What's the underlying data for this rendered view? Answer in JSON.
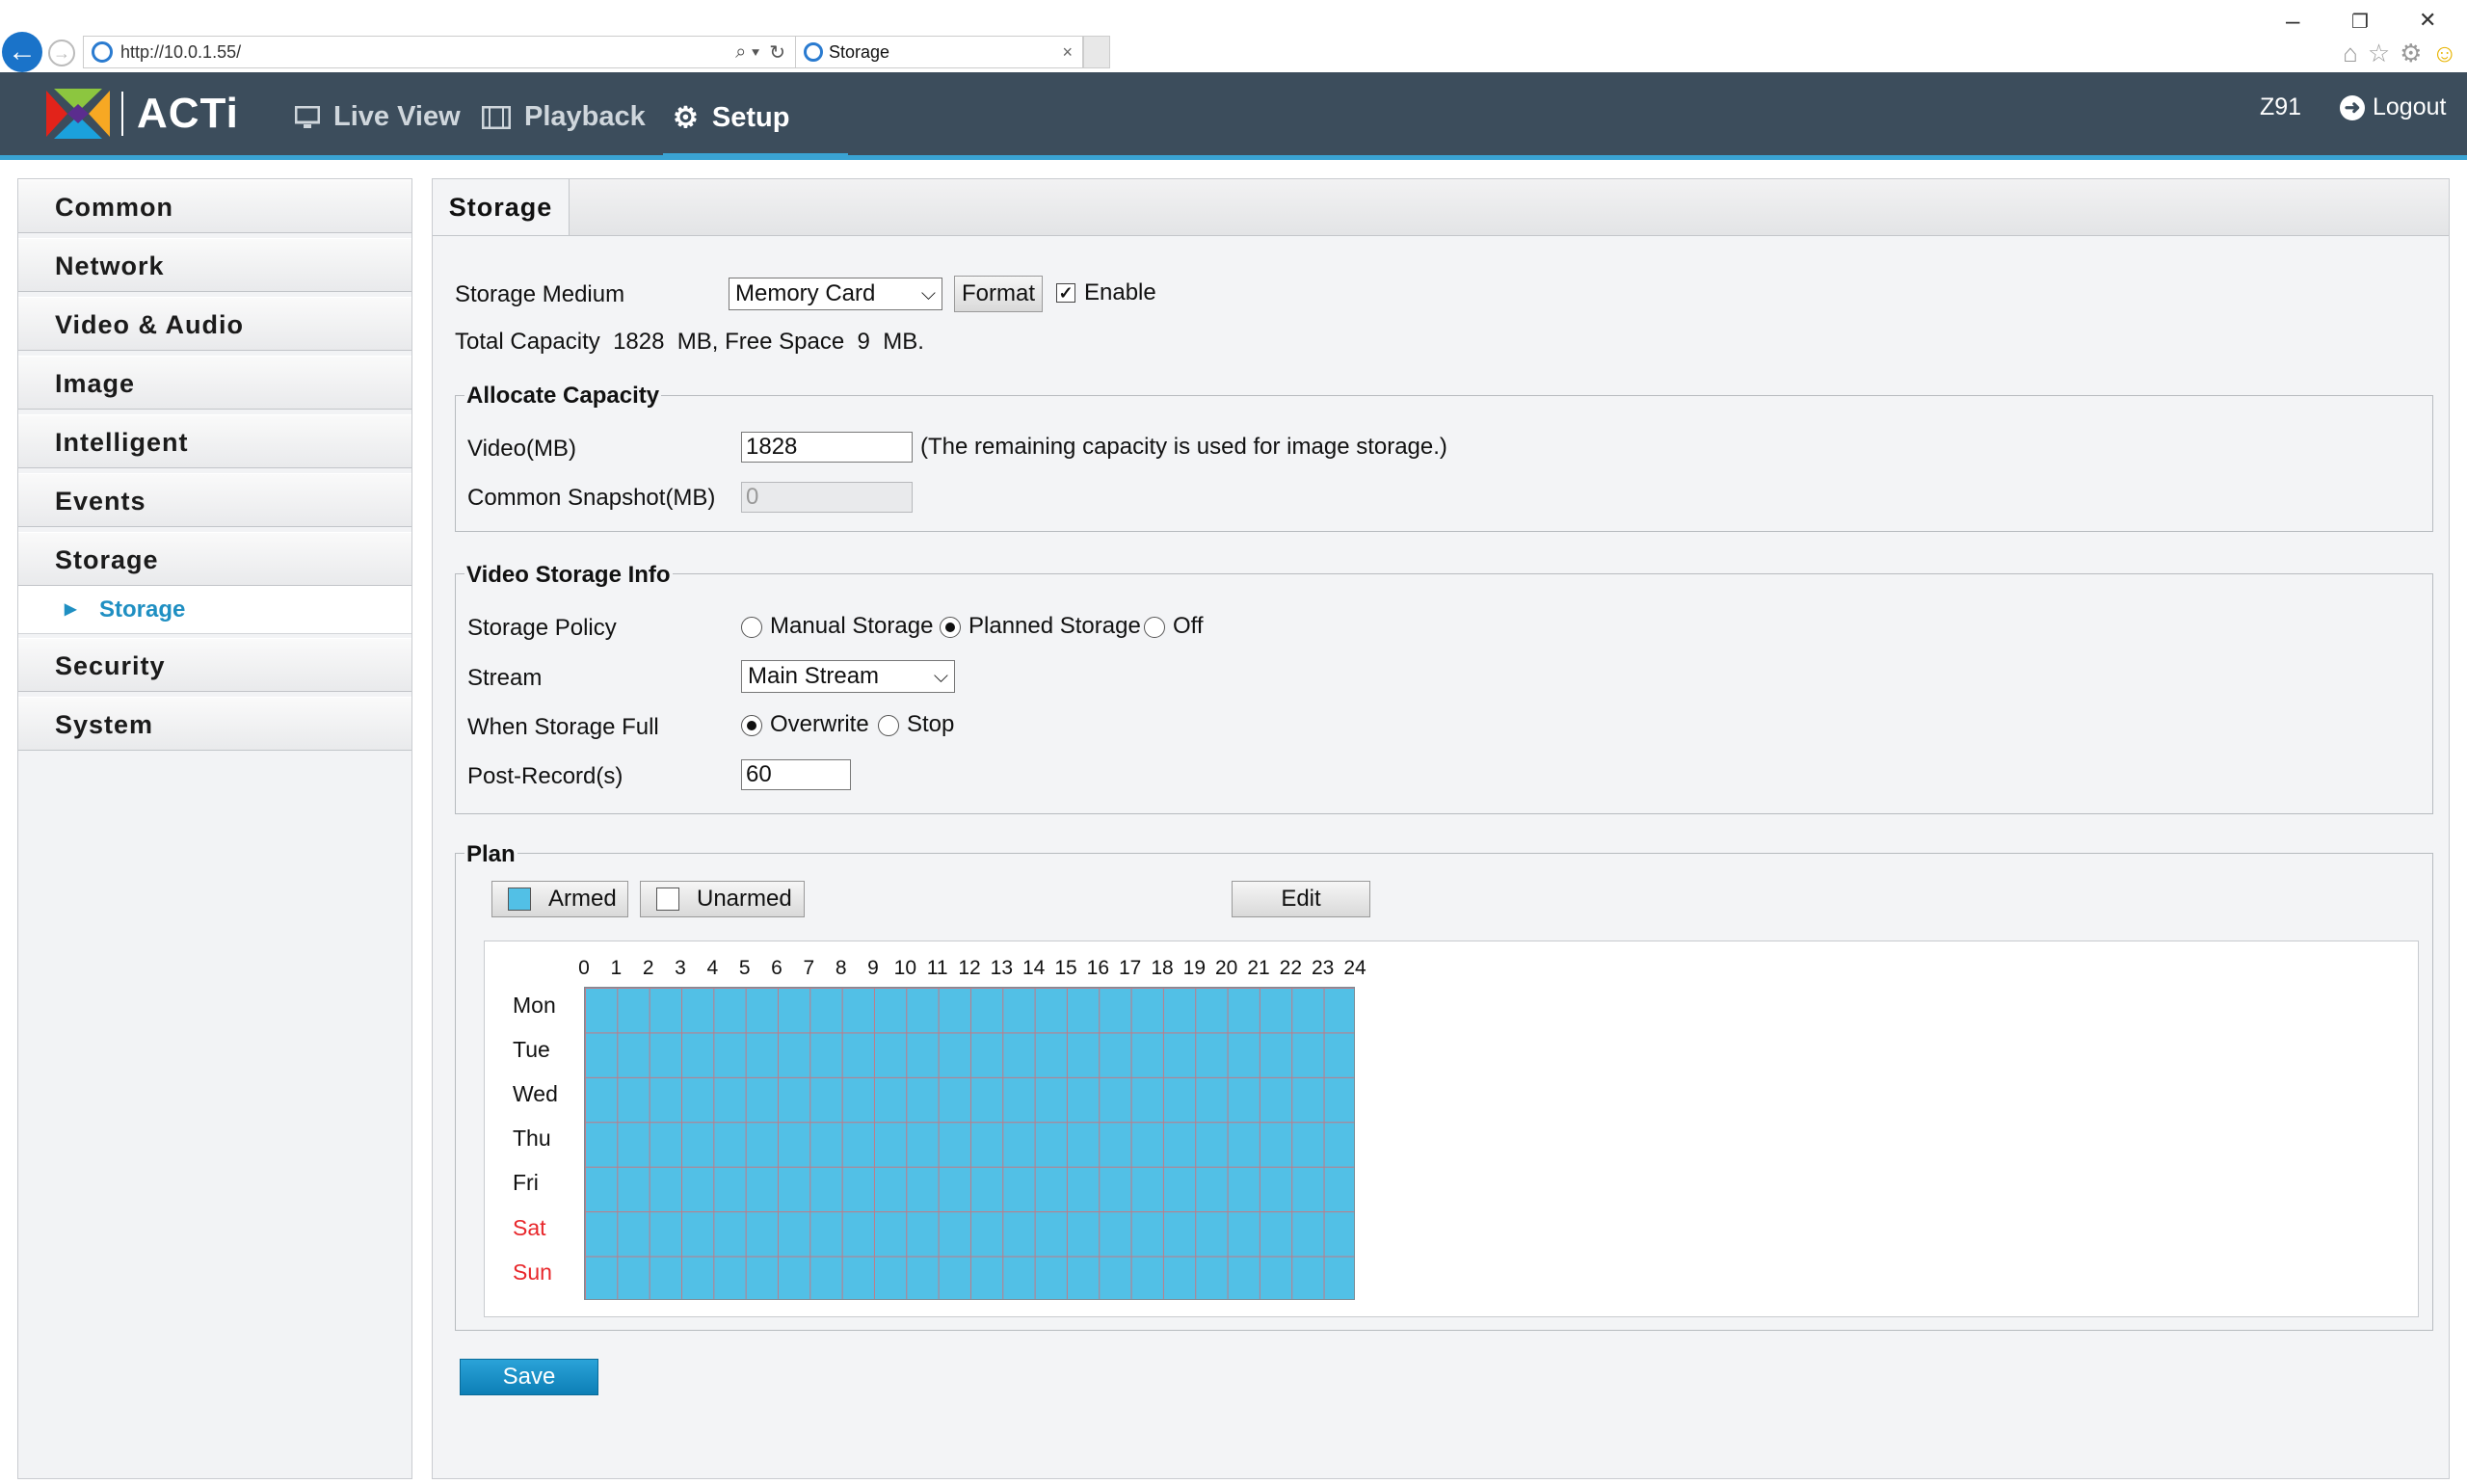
{
  "browser": {
    "url": "http://10.0.1.55/",
    "tab_title": "Storage",
    "tab_close": "×",
    "win_minimize": "–",
    "win_restore": "❐",
    "win_close": "✕"
  },
  "header": {
    "logo_text": "ACTi",
    "menu": {
      "live_view": "Live View",
      "playback": "Playback",
      "setup": "Setup"
    },
    "active_menu": "Setup",
    "device_name": "Z91",
    "logout": "Logout"
  },
  "sidebar": {
    "items": [
      "Common",
      "Network",
      "Video & Audio",
      "Image",
      "Intelligent",
      "Events",
      "Storage",
      "Security",
      "System"
    ],
    "sub_item": "Storage"
  },
  "panel": {
    "tab": "Storage",
    "storage_medium_label": "Storage Medium",
    "storage_medium_value": "Memory Card",
    "format_button": "Format",
    "enable_label": "Enable",
    "enable_checked": true,
    "capacity_text": "Total Capacity  1828  MB, Free Space  9  MB."
  },
  "allocate": {
    "legend": "Allocate Capacity",
    "video_label": "Video(MB)",
    "video_value": "1828",
    "video_note": "(The remaining capacity is used for image storage.)",
    "snapshot_label": "Common Snapshot(MB)",
    "snapshot_value": "0"
  },
  "video_info": {
    "legend": "Video Storage Info",
    "policy_label": "Storage Policy",
    "policy_options": [
      "Manual Storage",
      "Planned Storage",
      "Off"
    ],
    "policy_selected": "Planned Storage",
    "stream_label": "Stream",
    "stream_value": "Main Stream",
    "full_label": "When Storage Full",
    "full_options": [
      "Overwrite",
      "Stop"
    ],
    "full_selected": "Overwrite",
    "post_record_label": "Post-Record(s)",
    "post_record_value": "60"
  },
  "plan": {
    "legend": "Plan",
    "armed_label": "Armed",
    "unarmed_label": "Unarmed",
    "edit_button": "Edit",
    "hours": [
      "0",
      "1",
      "2",
      "3",
      "4",
      "5",
      "6",
      "7",
      "8",
      "9",
      "10",
      "11",
      "12",
      "13",
      "14",
      "15",
      "16",
      "17",
      "18",
      "19",
      "20",
      "21",
      "22",
      "23",
      "24"
    ],
    "days": [
      "Mon",
      "Tue",
      "Wed",
      "Thu",
      "Fri",
      "Sat",
      "Sun"
    ],
    "armed_color": "#52c0e6",
    "weekend_color": "#e8272b",
    "armed_all_hours": true
  },
  "save_button": "Save",
  "colors": {
    "header_bg": "#3c4d5c",
    "accent": "#3aa3d3"
  }
}
